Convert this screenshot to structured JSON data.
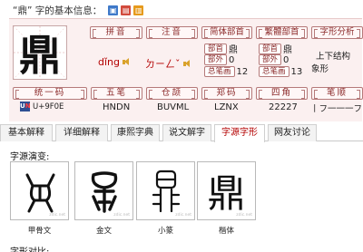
{
  "header": {
    "title": "“鼎” 字的基本信息："
  },
  "character": {
    "glyph": "鼎",
    "pinyin": "dǐng",
    "zhuyin": "ㄉㄧㄥˇ",
    "simplified": {
      "radical": "鼎",
      "radical_outside": "0",
      "total_strokes": "12"
    },
    "traditional": {
      "radical": "鼎",
      "radical_outside": "0",
      "total_strokes": "13"
    },
    "structure": "上下结构",
    "formation": "象形",
    "unicode": "U+9F0E",
    "wubi": "HNDN",
    "cangjie": "BUVML",
    "zhengma": "LZNX",
    "four_corner": "22227",
    "stroke_order": "丨フ一一一フ"
  },
  "labels": {
    "pinyin": "拼音",
    "zhuyin": "注音",
    "simplified": "简体部首",
    "traditional": "繁體部首",
    "analysis": "字形分析",
    "radical": "部首",
    "radical_outside": "部外",
    "total_strokes": "总笔画",
    "unicode": "统一码",
    "wubi": "五笔",
    "cangjie": "仓颉",
    "zhengma": "郑码",
    "four_corner": "四角",
    "stroke": "笔顺"
  },
  "tabs": [
    {
      "label": "基本解释",
      "active": false
    },
    {
      "label": "详细解释",
      "active": false
    },
    {
      "label": "康熙字典",
      "active": false
    },
    {
      "label": "说文解字",
      "active": false
    },
    {
      "label": "字源字形",
      "active": true
    },
    {
      "label": "网友讨论",
      "active": false
    }
  ],
  "evolution": {
    "title": "字源演变:",
    "items": [
      {
        "label": "甲骨文"
      },
      {
        "label": "金文"
      },
      {
        "label": "小篆"
      },
      {
        "label": "楷体"
      }
    ]
  },
  "comparison": {
    "title": "字形对比:"
  },
  "colors": {
    "accent_red": "#b30000",
    "panel_bg": "#fbf0f0",
    "tag_border": "#b57a7a"
  }
}
